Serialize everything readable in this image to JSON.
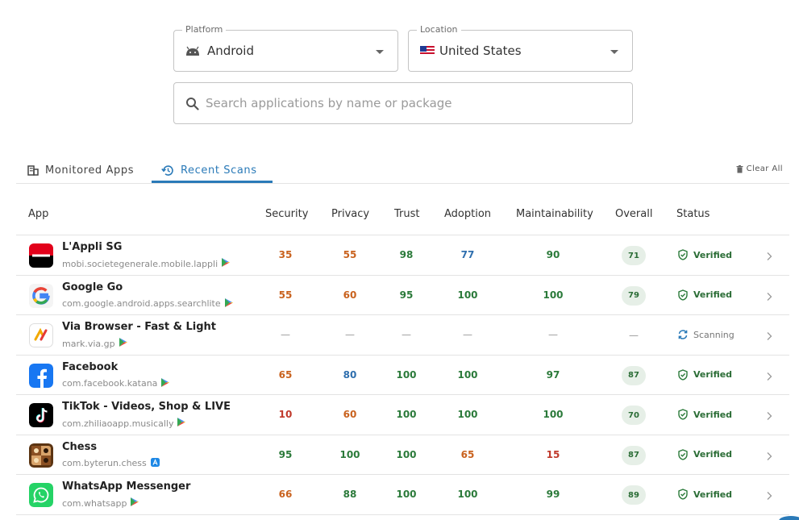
{
  "filters": {
    "platform": {
      "legend": "Platform",
      "value": "Android"
    },
    "location": {
      "legend": "Location",
      "value": "United States"
    },
    "search": {
      "placeholder": "Search applications by name or package"
    }
  },
  "tabs": {
    "monitored": "Monitored Apps",
    "recent": "Recent Scans",
    "active": "recent",
    "clear_all": "Clear All"
  },
  "table": {
    "headers": {
      "app": "App",
      "security": "Security",
      "privacy": "Privacy",
      "trust": "Trust",
      "adoption": "Adoption",
      "maintainability": "Maintainability",
      "overall": "Overall",
      "status": "Status"
    },
    "rows": [
      {
        "name": "L'Appli SG",
        "package": "mobi.societegenerale.mobile.lappli",
        "store": "google-play",
        "security": "35",
        "privacy": "55",
        "trust": "98",
        "adoption": "77",
        "maintainability": "90",
        "overall": "71",
        "status": "Verified"
      },
      {
        "name": "Google Go",
        "package": "com.google.android.apps.searchlite",
        "store": "google-play",
        "security": "55",
        "privacy": "60",
        "trust": "95",
        "adoption": "100",
        "maintainability": "100",
        "overall": "79",
        "status": "Verified"
      },
      {
        "name": "Via Browser - Fast & Light",
        "package": "mark.via.gp",
        "store": "google-play",
        "security": "—",
        "privacy": "—",
        "trust": "—",
        "adoption": "—",
        "maintainability": "—",
        "overall": "—",
        "status": "Scanning"
      },
      {
        "name": "Facebook",
        "package": "com.facebook.katana",
        "store": "google-play",
        "security": "65",
        "privacy": "80",
        "trust": "100",
        "adoption": "100",
        "maintainability": "97",
        "overall": "87",
        "status": "Verified"
      },
      {
        "name": "TikTok - Videos, Shop & LIVE",
        "package": "com.zhiliaoapp.musically",
        "store": "google-play",
        "security": "10",
        "privacy": "60",
        "trust": "100",
        "adoption": "100",
        "maintainability": "100",
        "overall": "70",
        "status": "Verified"
      },
      {
        "name": "Chess",
        "package": "com.byterun.chess",
        "store": "app-store",
        "security": "95",
        "privacy": "100",
        "trust": "100",
        "adoption": "65",
        "maintainability": "15",
        "overall": "87",
        "status": "Verified"
      },
      {
        "name": "WhatsApp Messenger",
        "package": "com.whatsapp",
        "store": "google-play",
        "security": "66",
        "privacy": "88",
        "trust": "100",
        "adoption": "100",
        "maintainability": "99",
        "overall": "89",
        "status": "Verified"
      }
    ]
  },
  "score_colors": {
    "high": "#2b7a3a",
    "mid": "#2f6fae",
    "low": "#c9621e",
    "critical": "#c0392b"
  }
}
